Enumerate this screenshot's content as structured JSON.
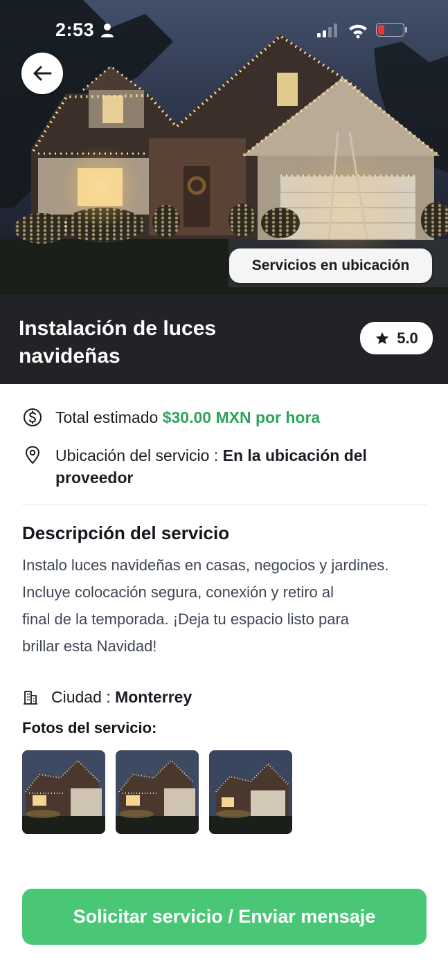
{
  "status_bar": {
    "time": "2:53",
    "person_icon": "person-icon",
    "signal_icon": "cellular-signal-icon",
    "wifi_icon": "wifi-icon",
    "battery_icon": "battery-low-icon",
    "battery_color": "#e53935"
  },
  "hero": {
    "back_icon": "arrow-left-icon",
    "location_badge": "Servicios en ubicación"
  },
  "header": {
    "title": "Instalación de luces navideñas",
    "rating": "5.0",
    "rating_icon": "star-icon"
  },
  "details": {
    "price_label": "Total estimado",
    "price_value": "$30.00 MXN por hora",
    "price_icon": "dollar-circle-icon",
    "location_label": "Ubicación del servicio :",
    "location_value": "En la ubicación del proveedor",
    "location_icon": "map-pin-icon"
  },
  "description": {
    "title": "Descripción del servicio",
    "lines": [
      "Instalo luces navideñas en casas, negocios y jardines.",
      "Incluye colocación segura, conexión y retiro al",
      "final de la temporada. ¡Deja tu espacio listo para",
      "brillar esta Navidad!"
    ]
  },
  "city": {
    "label": "Ciudad :",
    "value": "Monterrey",
    "icon": "building-icon"
  },
  "photos": {
    "title": "Fotos del servicio:"
  },
  "actions": {
    "primary": "Solicitar servicio / Enviar mensaje"
  },
  "colors": {
    "accent_green": "#4ac776",
    "price_green": "#2ea35a",
    "title_band": "#222326"
  }
}
